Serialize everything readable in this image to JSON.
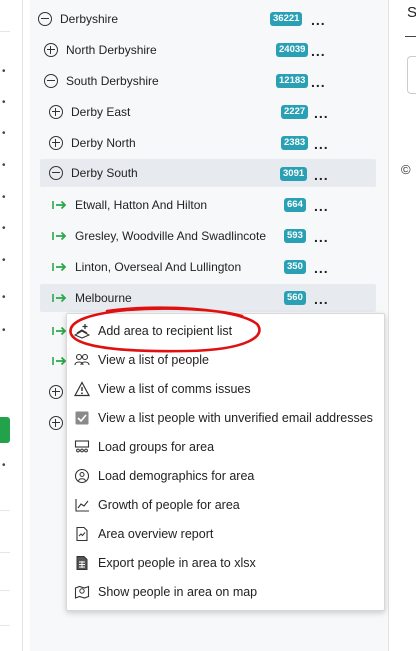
{
  "tree": {
    "items": [
      {
        "label": "Derbyshire",
        "count": "36221",
        "state": "expanded"
      },
      {
        "label": "North Derbyshire",
        "count": "24039",
        "state": "collapsed"
      },
      {
        "label": "South Derbyshire",
        "count": "12183",
        "state": "expanded"
      },
      {
        "label": "Derby East",
        "count": "2227",
        "state": "collapsed"
      },
      {
        "label": "Derby North",
        "count": "2383",
        "state": "collapsed"
      },
      {
        "label": "Derby South",
        "count": "3091",
        "state": "expanded"
      },
      {
        "label": "Etwall, Hatton And Hilton",
        "count": "664",
        "state": "leaf"
      },
      {
        "label": "Gresley, Woodville And Swadlincote",
        "count": "593",
        "state": "leaf"
      },
      {
        "label": "Linton, Overseal And Lullington",
        "count": "350",
        "state": "leaf"
      },
      {
        "label": "Melbourne",
        "count": "560",
        "state": "leaf"
      }
    ],
    "more_label": "..."
  },
  "context_menu": {
    "items": [
      {
        "label": "Add area to recipient list",
        "icon": "add-recipients-icon"
      },
      {
        "label": "View a list of people",
        "icon": "people-icon"
      },
      {
        "label": "View a list of comms issues",
        "icon": "warning-icon"
      },
      {
        "label": "View a list people with unverified email addresses",
        "icon": "checkbox-icon"
      },
      {
        "label": "Load groups for area",
        "icon": "groups-icon"
      },
      {
        "label": "Load demographics for area",
        "icon": "demographics-icon"
      },
      {
        "label": "Growth of people for area",
        "icon": "growth-chart-icon"
      },
      {
        "label": "Area overview report",
        "icon": "report-icon"
      },
      {
        "label": "Export people in area to xlsx",
        "icon": "spreadsheet-icon"
      },
      {
        "label": "Show people in area on map",
        "icon": "map-icon"
      }
    ]
  },
  "right_panel": {
    "heading_fragment": "S",
    "copyright_symbol": "©"
  },
  "colors": {
    "badge": "#2aa0b5",
    "arrow_green": "#2aa84a",
    "highlight": "#e7ebf0",
    "annotation_red": "#e01010"
  }
}
